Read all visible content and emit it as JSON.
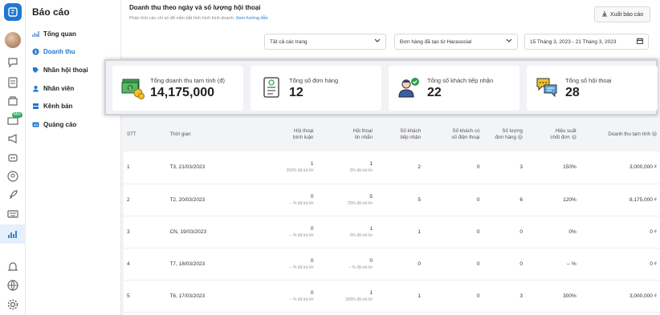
{
  "sidebar": {
    "title": "Báo cáo",
    "new_badge": "Mới",
    "items": [
      {
        "label": "Tổng quan",
        "icon": "chart-icon"
      },
      {
        "label": "Doanh thu",
        "icon": "revenue-icon",
        "active": true
      },
      {
        "label": "Nhãn hội thoại",
        "icon": "tag-icon"
      },
      {
        "label": "Nhân viên",
        "icon": "user-icon"
      },
      {
        "label": "Kênh bán",
        "icon": "channel-icon"
      },
      {
        "label": "Quảng cáo",
        "icon": "ads-icon"
      }
    ]
  },
  "header": {
    "title": "Doanh thu theo ngày và số lượng hội thoại",
    "subtitle": "Phân tích các chỉ số để nắm bắt tình hình kinh doanh.",
    "guide_link": "Xem hướng dẫn",
    "export_label": "Xuất báo cáo"
  },
  "filters": {
    "page_select": "Tất cả các trang",
    "order_select": "Đơn hàng đã tạo từ Harasocial",
    "date_range": "15 Tháng 3, 2023 - 21 Tháng 3, 2023"
  },
  "cards": [
    {
      "label": "Tổng doanh thu tạm tính (đ)",
      "value": "14,175,000",
      "icon": "money-icon"
    },
    {
      "label": "Tổng số đơn hàng",
      "value": "12",
      "icon": "order-list-icon"
    },
    {
      "label": "Tổng số khách tiếp nhận",
      "value": "22",
      "icon": "customer-check-icon"
    },
    {
      "label": "Tổng số hội thoại",
      "value": "28",
      "icon": "chat-bubbles-icon"
    }
  ],
  "table": {
    "headers": {
      "stt": "STT",
      "time": "Thời gian",
      "comment_conv_1": "Hội thoại",
      "comment_conv_2": "bình luận",
      "message_conv_1": "Hội thoại",
      "message_conv_2": "tin nhắn",
      "customers_1": "Số khách",
      "customers_2": "tiếp nhận",
      "phone_1": "Số khách có",
      "phone_2": "số điện thoại",
      "orders_1": "Số lượng",
      "orders_2": "đơn hàng",
      "rate_1": "Hiệu suất",
      "rate_2": "chốt đơn",
      "revenue": "Doanh thu tạm tính"
    },
    "rows": [
      {
        "stt": "1",
        "time": "T3, 21/03/2023",
        "comment": "1",
        "comment_sub": "200% đã trả lời",
        "message": "1",
        "message_sub": "0% đã trả lời",
        "customers": "2",
        "phone": "0",
        "orders": "3",
        "rate": "150%",
        "revenue": "3,000,000 ₫"
      },
      {
        "stt": "2",
        "time": "T2, 20/03/2023",
        "comment": "0",
        "comment_sub": "-- % đã trả lời",
        "message": "5",
        "message_sub": "20% đã trả lời",
        "customers": "5",
        "phone": "0",
        "orders": "6",
        "rate": "120%",
        "revenue": "8,175,000 ₫"
      },
      {
        "stt": "3",
        "time": "CN, 19/03/2023",
        "comment": "0",
        "comment_sub": "-- % đã trả lời",
        "message": "1",
        "message_sub": "0% đã trả lời",
        "customers": "1",
        "phone": "0",
        "orders": "0",
        "rate": "0%",
        "revenue": "0 ₫"
      },
      {
        "stt": "4",
        "time": "T7, 18/03/2023",
        "comment": "0",
        "comment_sub": "-- % đã trả lời",
        "message": "0",
        "message_sub": "-- % đã trả lời",
        "customers": "0",
        "phone": "0",
        "orders": "0",
        "rate": "-- %",
        "revenue": "0 ₫"
      },
      {
        "stt": "5",
        "time": "T6, 17/03/2023",
        "comment": "0",
        "comment_sub": "-- % đã trả lời",
        "message": "1",
        "message_sub": "300% đã trả lời",
        "customers": "1",
        "phone": "0",
        "orders": "3",
        "rate": "300%",
        "revenue": "3,000,000 ₫"
      }
    ]
  },
  "colors": {
    "accent": "#1f78d1",
    "badge_green": "#27ae60"
  }
}
